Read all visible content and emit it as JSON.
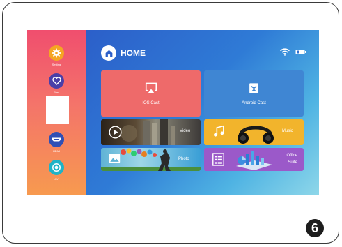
{
  "sidebar": {
    "items": [
      {
        "label": "Setting",
        "icon": "gear-icon",
        "color": "#f5a623"
      },
      {
        "label": "Files",
        "icon": "heart-icon",
        "color": "#4a3fa8"
      },
      {
        "label": "HDMI",
        "icon": "hdmi-icon",
        "color": "#2f6fd0"
      },
      {
        "label": "AV",
        "icon": "av-icon",
        "color": "#1fb3c7"
      }
    ]
  },
  "header": {
    "title": "HOME",
    "wifi_icon": "wifi-icon",
    "battery_icon": "battery-icon"
  },
  "tiles": {
    "ios_cast": {
      "label": "IOS Cast",
      "color": "#ee6a6a"
    },
    "android_cast": {
      "label": "Android Cast",
      "color": "#3f86d3"
    },
    "video": {
      "label": "Video"
    },
    "music": {
      "label": "Music",
      "color": "#f2b42c"
    },
    "photo": {
      "label": "Photo"
    },
    "office_suite": {
      "label_line1": "Office",
      "label_line2": "Suite",
      "color": "#9b59c9"
    }
  },
  "step_badge": "6"
}
